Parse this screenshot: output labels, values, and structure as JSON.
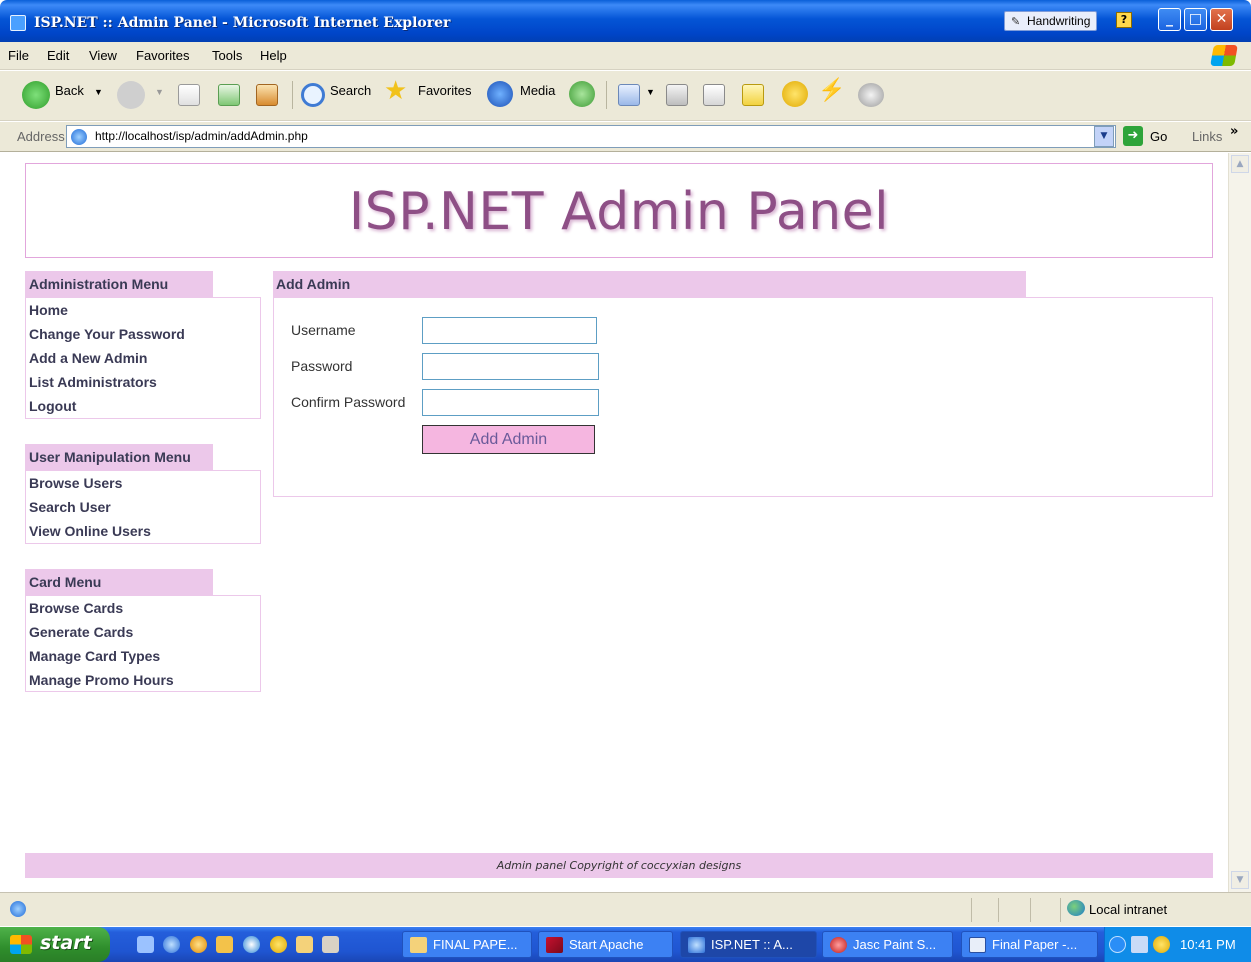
{
  "window": {
    "title": "ISP.NET :: Admin Panel - Microsoft Internet Explorer",
    "language_bar": "Handwriting",
    "help_icon": "?",
    "minimize_icon": "_",
    "maximize_icon": "□",
    "close_icon": "✕"
  },
  "menubar": [
    "File",
    "Edit",
    "View",
    "Favorites",
    "Tools",
    "Help"
  ],
  "toolbar": {
    "back": "Back",
    "search": "Search",
    "favorites": "Favorites",
    "media": "Media"
  },
  "address": {
    "label": "Address",
    "url": "http://localhost/isp/admin/addAdmin.php",
    "go": "Go",
    "links": "Links"
  },
  "page": {
    "header_title": "ISP.NET Admin Panel",
    "admin_menu": {
      "title": "Administration Menu",
      "items": [
        "Home",
        "Change Your Password",
        "Add a New Admin",
        "List Administrators",
        "Logout"
      ]
    },
    "user_menu": {
      "title": "User Manipulation Menu",
      "items": [
        "Browse Users",
        "Search User",
        "View Online Users"
      ]
    },
    "card_menu": {
      "title": "Card Menu",
      "items": [
        "Browse Cards",
        "Generate Cards",
        "Manage Card Types",
        "Manage Promo Hours"
      ]
    },
    "form": {
      "title": "Add Admin",
      "username_label": "Username",
      "password_label": "Password",
      "confirm_label": "Confirm Password",
      "username_value": "",
      "password_value": "",
      "confirm_value": "",
      "submit": "Add Admin"
    },
    "footer": "Admin panel Copyright of coccyxian designs"
  },
  "statusbar": {
    "zone": "Local intranet"
  },
  "taskbar": {
    "start": "start",
    "tasks": [
      "FINAL PAPE...",
      "Start Apache",
      "ISP.NET :: A...",
      "Jasc Paint S...",
      "Final Paper -..."
    ],
    "clock": "10:41 PM"
  },
  "colors": {
    "accent_pink": "#ecc8ea",
    "header_text": "#8e4f86",
    "button_pink": "#f5b6e0"
  }
}
